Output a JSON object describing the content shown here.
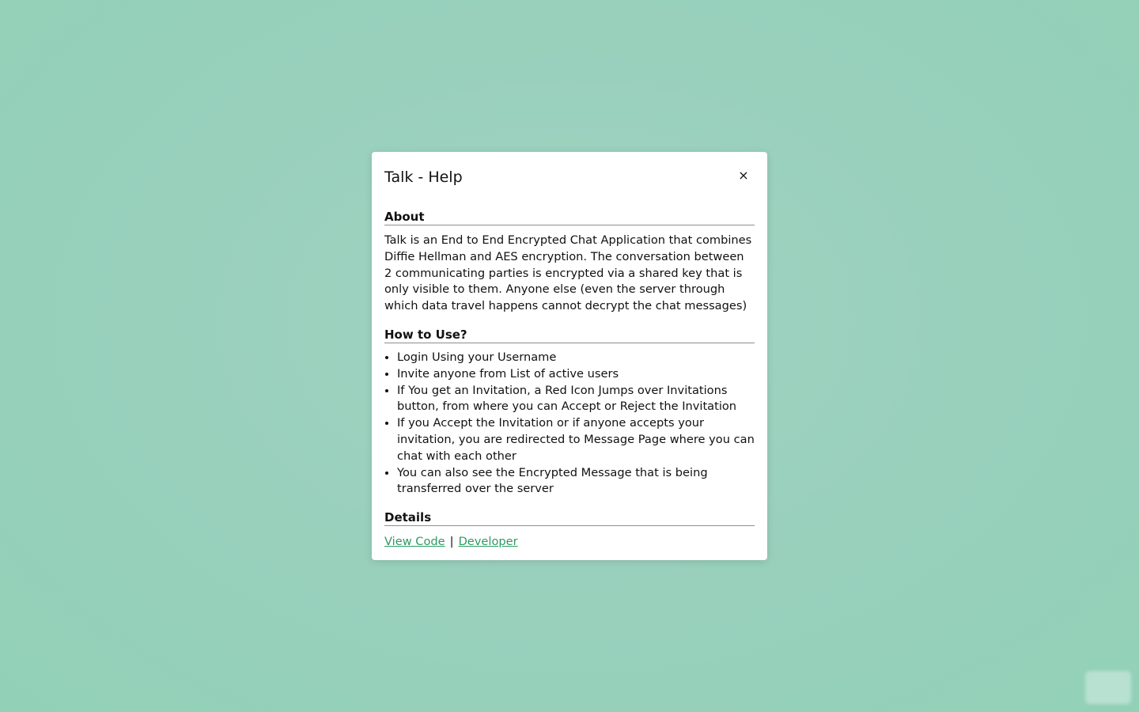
{
  "modal": {
    "title": "Talk - Help",
    "close_label": "×",
    "about": {
      "heading": "About",
      "text": "Talk is an End to End Encrypted Chat Application that combines Diffie Hellman and AES encryption. The conversation between 2 communicating parties is encrypted via a shared key that is only visible to them. Anyone else (even the server through which data travel happens cannot decrypt the chat messages)"
    },
    "how_to_use": {
      "heading": "How to Use?",
      "steps": [
        "Login Using your Username",
        "Invite anyone from List of active users",
        "If You get an Invitation, a Red Icon Jumps over Invitations button, from where you can Accept or Reject the Invitation",
        "If you Accept the Invitation or if anyone accepts your invitation, you are redirected to Message Page where you can chat with each other",
        "You can also see the Encrypted Message that is being transferred over the server"
      ]
    },
    "details": {
      "heading": "Details",
      "view_code_label": "View Code",
      "separator": "|",
      "developer_label": "Developer"
    }
  },
  "colors": {
    "background": "#99d0bd",
    "link": "#2e9a63",
    "modal_background": "#ffffff"
  }
}
